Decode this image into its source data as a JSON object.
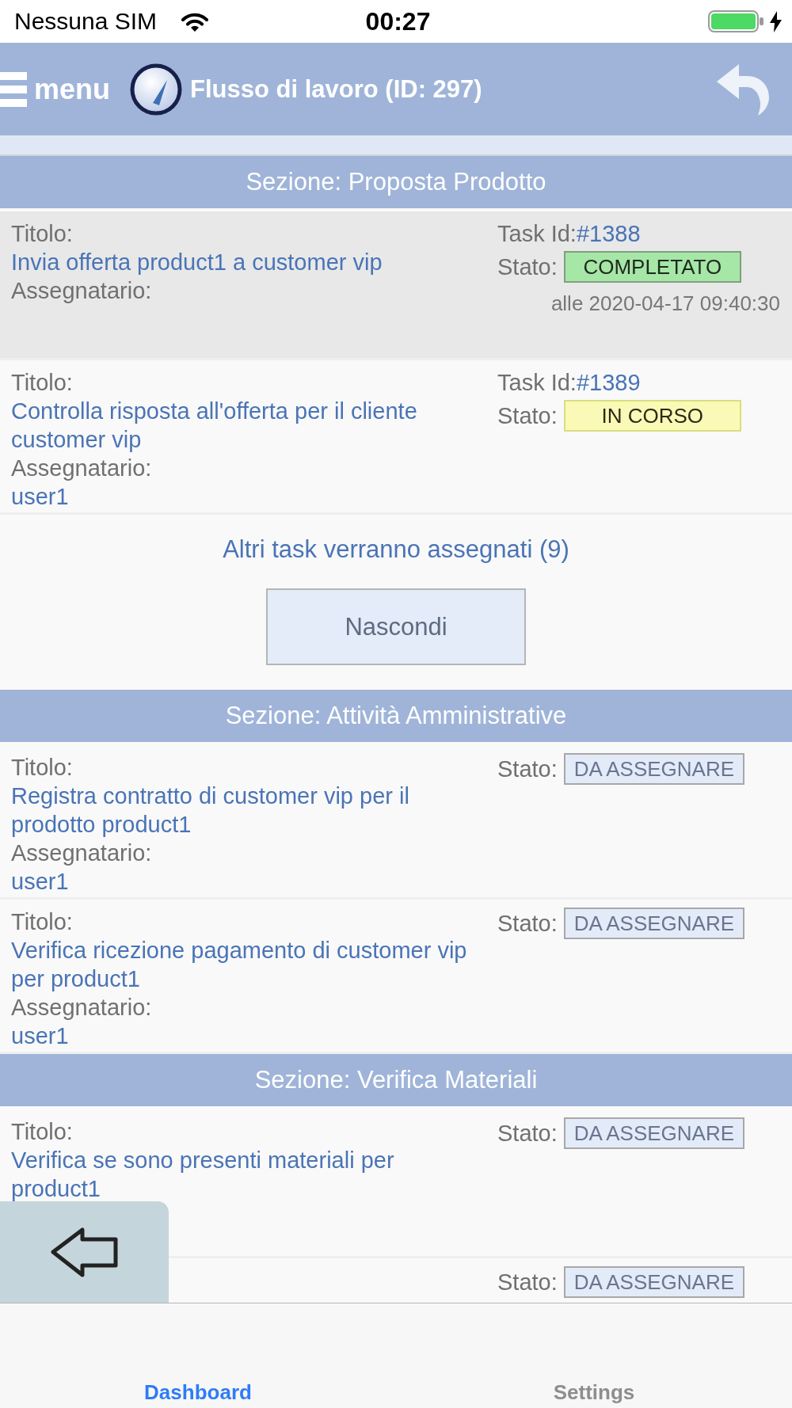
{
  "status_bar": {
    "carrier": "Nessuna SIM",
    "time": "00:27"
  },
  "header": {
    "menu_label": "menu",
    "title": "Flusso di lavoro (ID: 297)"
  },
  "sections": [
    {
      "title": "Sezione: Proposta Prodotto",
      "tasks": [
        {
          "title_label": "Titolo:",
          "title": "Invia offerta product1 a customer vip",
          "assignee_label": "Assegnatario:",
          "task_id_label": "Task Id:",
          "task_id": "#1388",
          "status_label": "Stato:",
          "status": "COMPLETATO",
          "kind": "completed",
          "completed_at": "alle 2020-04-17 09:40:30"
        },
        {
          "title_label": "Titolo:",
          "title": "Controlla risposta all'offerta per il cliente customer vip",
          "assignee_label": "Assegnatario:",
          "assignee": "user1",
          "task_id_label": "Task Id:",
          "task_id": "#1389",
          "status_label": "Stato:",
          "status": "IN CORSO",
          "kind": "in_progress"
        }
      ],
      "pending_note": "Altri task verranno assegnati (9)",
      "toggle_button": "Nascondi"
    },
    {
      "title": "Sezione: Attività Amministrative",
      "tasks": [
        {
          "title_label": "Titolo:",
          "title": "Registra contratto di customer vip per il prodotto product1",
          "assignee_label": "Assegnatario:",
          "assignee": "user1",
          "status_label": "Stato:",
          "status": "DA ASSEGNARE",
          "kind": "unassigned"
        },
        {
          "title_label": "Titolo:",
          "title": "Verifica ricezione pagamento di customer vip per product1",
          "assignee_label": "Assegnatario:",
          "assignee": "user1",
          "status_label": "Stato:",
          "status": "DA ASSEGNARE",
          "kind": "unassigned"
        }
      ]
    },
    {
      "title": "Sezione: Verifica Materiali",
      "tasks": [
        {
          "title_label": "Titolo:",
          "title": "Verifica se sono presenti materiali per product1",
          "status_label": "Stato:",
          "status": "DA ASSEGNARE",
          "kind": "unassigned"
        },
        {
          "status_label": "Stato:",
          "status": "DA ASSEGNARE",
          "kind": "unassigned"
        }
      ]
    }
  ],
  "tab_bar": [
    {
      "label": "Dashboard",
      "selected": true
    },
    {
      "label": "Settings",
      "selected": false
    }
  ]
}
